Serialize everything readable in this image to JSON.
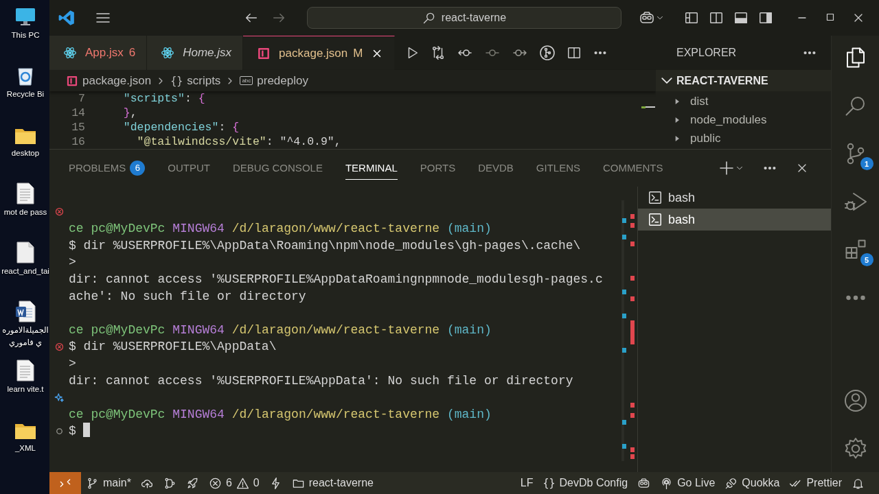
{
  "desktop": {
    "icons": [
      {
        "kind": "computer",
        "label": "This PC"
      },
      {
        "kind": "recycle-bin",
        "label": "Recycle Bi"
      },
      {
        "kind": "folder",
        "label": "desktop"
      },
      {
        "kind": "text-file",
        "label": "mot de pass"
      },
      {
        "kind": "blank-file",
        "label": "react_and_tai"
      },
      {
        "kind": "word-file",
        "label": "الجميلةالاموره",
        "label_line_2": "ي فاموري"
      },
      {
        "kind": "text-file",
        "label": "learn vite.t"
      },
      {
        "kind": "folder",
        "label": "_XML"
      }
    ]
  },
  "title_bar": {
    "search": "react-taverne"
  },
  "editor_tabs": [
    {
      "kind": "react",
      "label": "App.jsx",
      "has_errors": true,
      "modified": false,
      "badge": "6",
      "preview": false,
      "selected": false
    },
    {
      "kind": "react",
      "label": "Home.jsx",
      "has_errors": false,
      "modified": false,
      "preview": true,
      "selected": false
    },
    {
      "kind": "json",
      "label": "package.json",
      "has_errors": false,
      "modified": true,
      "badge": "M",
      "preview": false,
      "selected": true
    }
  ],
  "breadcrumbs": [
    {
      "kind": "json-file",
      "label": "package.json"
    },
    {
      "kind": "object",
      "glyph": "{}",
      "label": "scripts"
    },
    {
      "kind": "string",
      "glyph": "abc",
      "label": "predeploy"
    }
  ],
  "code_lines": [
    {
      "number": "7",
      "tokens": [
        {
          "kind": "key",
          "text": "  \"scripts\""
        },
        {
          "kind": "punct",
          "text": ": "
        },
        {
          "kind": "brace",
          "text": "{"
        }
      ]
    },
    {
      "number": "14",
      "tokens": [
        {
          "kind": "brace",
          "text": "  }"
        },
        {
          "kind": "punct",
          "text": ","
        }
      ]
    },
    {
      "number": "15",
      "tokens": [
        {
          "kind": "key",
          "text": "  \"dependencies\""
        },
        {
          "kind": "punct",
          "text": ": "
        },
        {
          "kind": "brace",
          "text": "{"
        }
      ]
    },
    {
      "number": "16",
      "tokens": [
        {
          "kind": "subkey",
          "text": "    \"@tailwindcss/vite\""
        },
        {
          "kind": "punct",
          "text": ": "
        },
        {
          "kind": "string",
          "text": "\"^4.0.9\""
        },
        {
          "kind": "punct",
          "text": ","
        }
      ]
    }
  ],
  "explorer": {
    "title": "EXPLORER",
    "root": {
      "label": "REACT-TAVERNE",
      "expanded": true,
      "children": [
        {
          "label": "dist",
          "expanded": false
        },
        {
          "label": "node_modules",
          "expanded": false
        },
        {
          "label": "public",
          "expanded": false
        }
      ]
    }
  },
  "panel": {
    "tabs": [
      {
        "label": "PROBLEMS",
        "badge": "6",
        "selected": false
      },
      {
        "label": "OUTPUT",
        "selected": false
      },
      {
        "label": "DEBUG CONSOLE",
        "selected": false
      },
      {
        "label": "TERMINAL",
        "selected": true
      },
      {
        "label": "PORTS",
        "selected": false
      },
      {
        "label": "DEVDB",
        "selected": false
      },
      {
        "label": "GITLENS",
        "selected": false
      },
      {
        "label": "COMMENTS",
        "selected": false
      }
    ],
    "terminal_lines": [
      {
        "kind": "blank"
      },
      {
        "kind": "blank",
        "decoration": {
          "kind": "error"
        }
      },
      {
        "kind": "prompt",
        "user": "ce pc@MyDevPc",
        "shell": "MINGW64",
        "path": "/d/laragon/www/react-taverne",
        "branch": "(main)"
      },
      {
        "kind": "text",
        "text": "$ dir %USERPROFILE%\\AppData\\Roaming\\npm\\node_modules\\gh-pages\\.cache\\"
      },
      {
        "kind": "text",
        "text": ">"
      },
      {
        "kind": "text",
        "text": "dir: cannot access '%USERPROFILE%AppDataRoamingnpmnode_modulesgh-pages.c"
      },
      {
        "kind": "text",
        "text": "ache': No such file or directory"
      },
      {
        "kind": "blank"
      },
      {
        "kind": "prompt",
        "user": "ce pc@MyDevPc",
        "shell": "MINGW64",
        "path": "/d/laragon/www/react-taverne",
        "branch": "(main)"
      },
      {
        "kind": "text",
        "text": "$ dir %USERPROFILE%\\AppData\\",
        "decoration": {
          "kind": "error"
        }
      },
      {
        "kind": "text",
        "text": ">"
      },
      {
        "kind": "text",
        "text": "dir: cannot access '%USERPROFILE%AppData': No such file or directory"
      },
      {
        "kind": "blank",
        "decoration": {
          "kind": "sparkle"
        }
      },
      {
        "kind": "prompt",
        "user": "ce pc@MyDevPc",
        "shell": "MINGW64",
        "path": "/d/laragon/www/react-taverne",
        "branch": "(main)"
      },
      {
        "kind": "input",
        "text": "$",
        "decoration": {
          "kind": "pending"
        }
      }
    ],
    "terminals": [
      {
        "label": "bash",
        "selected": false
      },
      {
        "label": "bash",
        "selected": true
      }
    ]
  },
  "activity_bar": {
    "top": [
      {
        "kind": "explorer",
        "selected": true
      },
      {
        "kind": "search",
        "selected": false
      },
      {
        "kind": "source-control",
        "badge": "1",
        "selected": false
      },
      {
        "kind": "run-debug",
        "selected": false
      },
      {
        "kind": "extensions",
        "badge": "5",
        "selected": false
      },
      {
        "kind": "more",
        "selected": false
      }
    ],
    "bottom": [
      {
        "kind": "accounts",
        "selected": false
      },
      {
        "kind": "manage",
        "selected": false
      }
    ]
  },
  "status_bar": {
    "left": [
      {
        "kind": "remote"
      },
      {
        "kind": "branch",
        "text": "main*"
      },
      {
        "kind": "publish"
      },
      {
        "kind": "git-graph"
      },
      {
        "kind": "deploy"
      },
      {
        "kind": "problems",
        "errors": "6",
        "warnings": "0"
      },
      {
        "kind": "lightning"
      },
      {
        "kind": "folder",
        "text": "react-taverne"
      }
    ],
    "right": [
      {
        "kind": "eol",
        "text": "LF"
      },
      {
        "kind": "braces",
        "glyph": "{}",
        "text": "DevDb Config"
      },
      {
        "kind": "copilot"
      },
      {
        "kind": "broadcast",
        "text": "Go Live"
      },
      {
        "kind": "plug",
        "text": "Quokka"
      },
      {
        "kind": "double-check",
        "text": "Prettier"
      },
      {
        "kind": "bell"
      }
    ]
  }
}
